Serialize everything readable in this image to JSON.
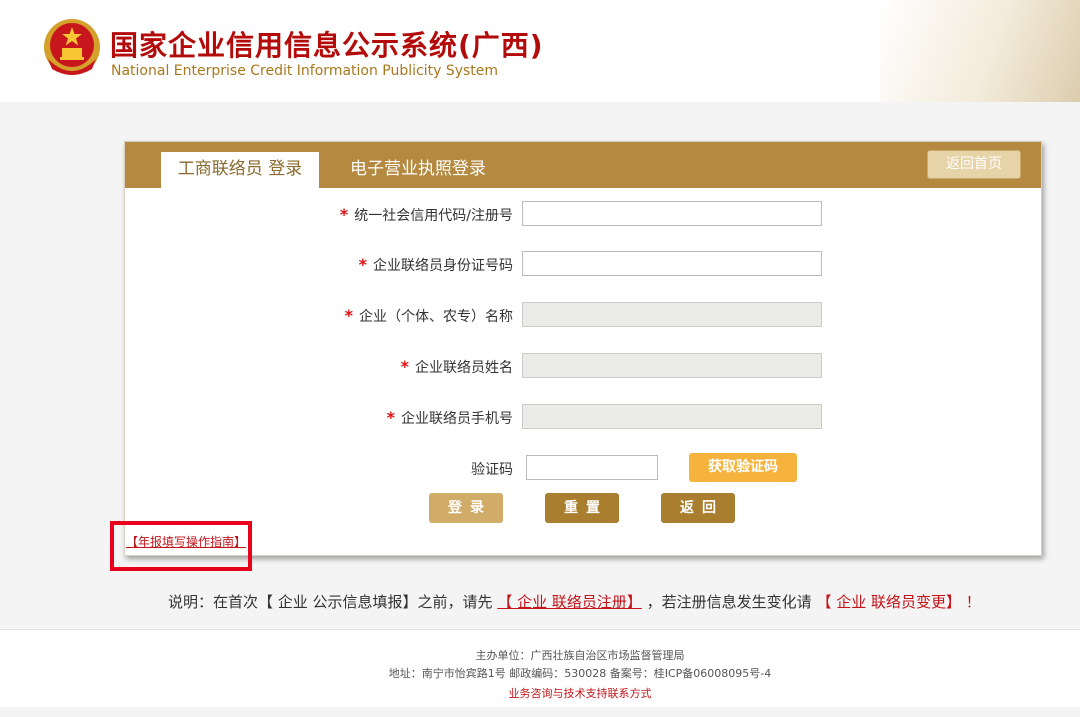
{
  "header": {
    "title": "国家企业信用信息公示系统(广西)",
    "subtitle": "National Enterprise Credit Information Publicity System"
  },
  "panel": {
    "tabs": [
      {
        "label": "工商联络员 登录",
        "active": true
      },
      {
        "label": "电子营业执照登录",
        "active": false
      }
    ],
    "home_button": "返回首页"
  },
  "form": {
    "required_mark": "*",
    "fields": [
      {
        "label": "统一社会信用代码/注册号",
        "value": "",
        "disabled": false
      },
      {
        "label": "企业联络员身份证号码",
        "value": "",
        "disabled": false
      },
      {
        "label": "企业（个体、农专）名称",
        "value": "",
        "disabled": true
      },
      {
        "label": "企业联络员姓名",
        "value": "",
        "disabled": true
      },
      {
        "label": "企业联络员手机号",
        "value": "",
        "disabled": true
      }
    ],
    "captcha_label": "验证码",
    "captcha_value": "",
    "captcha_button": "获取验证码",
    "buttons": {
      "login": "登录",
      "reset": "重置",
      "back": "返回"
    }
  },
  "guide_link": "【年报填写操作指南】",
  "note": {
    "prefix": "说明：在首次【 企业 公示信息填报】之前，请先",
    "register_link": "【 企业 联络员注册】",
    "middle": "，若注册信息发生变化请",
    "change_link": "【 企业 联络员变更】",
    "suffix": "！"
  },
  "footer": {
    "host": "主办单位：广西壮族自治区市场监督管理局",
    "address": "地址：南宁市怡宾路1号 邮政编码：530028    备案号：桂ICP备06008095号-4",
    "contact_link": "业务咨询与技术支持联系方式"
  },
  "colors": {
    "title_red": "#b30a0a",
    "panel_brown": "#b5893f",
    "captcha_orange": "#f5b23c",
    "link_red": "#c4141a"
  }
}
